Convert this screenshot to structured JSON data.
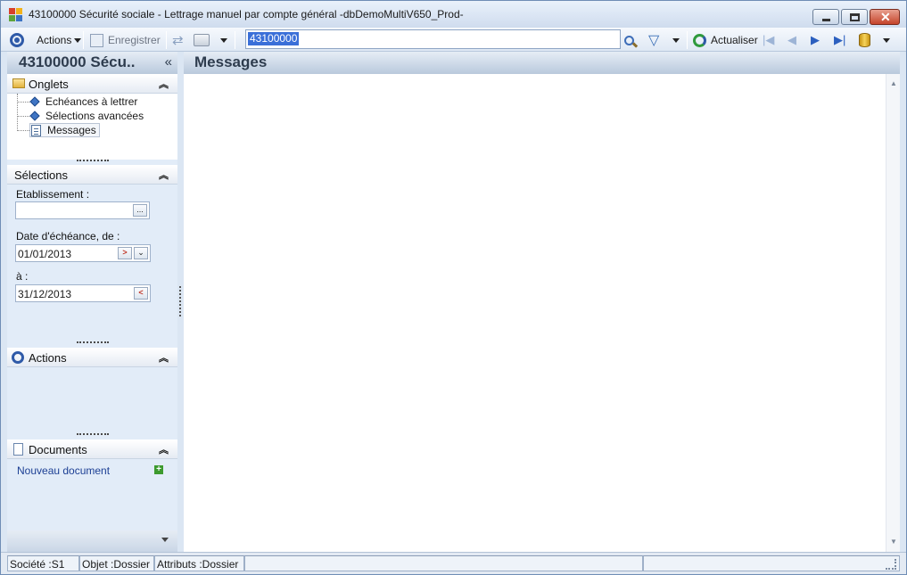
{
  "window": {
    "title": "43100000 Sécurité sociale -  Lettrage manuel par compte général -dbDemoMultiV650_Prod-"
  },
  "toolbar": {
    "actions_label": "Actions",
    "save_label": "Enregistrer",
    "search_value": "43100000",
    "refresh_label": "Actualiser"
  },
  "left_panel": {
    "title": "43100000 Sécu..",
    "collapse_glyph": "«",
    "tabs_section": {
      "title": "Onglets",
      "items": [
        {
          "label": "Echéances à lettrer",
          "icon": "diamond-icon"
        },
        {
          "label": "Sélections avancées",
          "icon": "diamond-icon"
        },
        {
          "label": "Messages",
          "icon": "document-icon"
        }
      ]
    },
    "selections_section": {
      "title": "Sélections",
      "etablissement_label": "Etablissement :",
      "etablissement_value": "",
      "browse_glyph": "...",
      "date_from_label": "Date d'échéance, de :",
      "date_from_value": "01/01/2013",
      "date_to_label": "à :",
      "date_to_value": "31/12/2013"
    },
    "actions_section": {
      "title": "Actions"
    },
    "documents_section": {
      "title": "Documents",
      "new_document_label": "Nouveau document"
    }
  },
  "main": {
    "title": "Messages"
  },
  "status_bar": {
    "company": "Société :S1",
    "object": "Objet :Dossier",
    "attributes": "Attributs :Dossier"
  },
  "colors": {
    "accent": "#2f5aa8",
    "panel_bg": "#e2ecf8",
    "link": "#1c3f94"
  }
}
